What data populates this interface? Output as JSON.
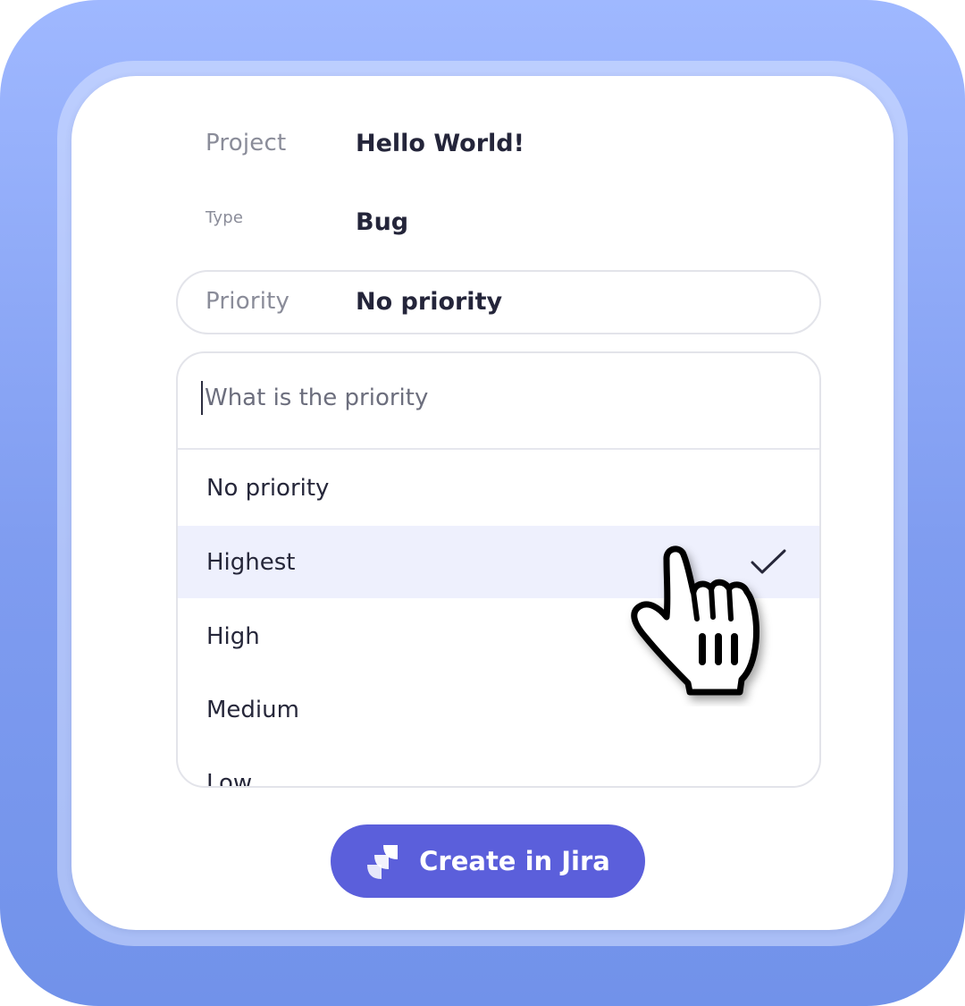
{
  "form": {
    "project": {
      "label": "Project",
      "value": "Hello World!"
    },
    "type": {
      "label": "Type",
      "value": "Bug"
    },
    "priority": {
      "label": "Priority",
      "value": "No priority"
    }
  },
  "dropdown": {
    "search_placeholder": "What is the priority",
    "options": [
      {
        "label": "No priority",
        "selected": false
      },
      {
        "label": "Highest",
        "selected": true
      },
      {
        "label": "High",
        "selected": false
      },
      {
        "label": "Medium",
        "selected": false
      },
      {
        "label": "Low",
        "selected": false
      }
    ]
  },
  "action": {
    "create_label": "Create in Jira",
    "icon": "jira-icon"
  },
  "colors": {
    "accent": "#5b5fdb",
    "selected_row": "#eef0fd",
    "background": "#8aa5f5"
  }
}
